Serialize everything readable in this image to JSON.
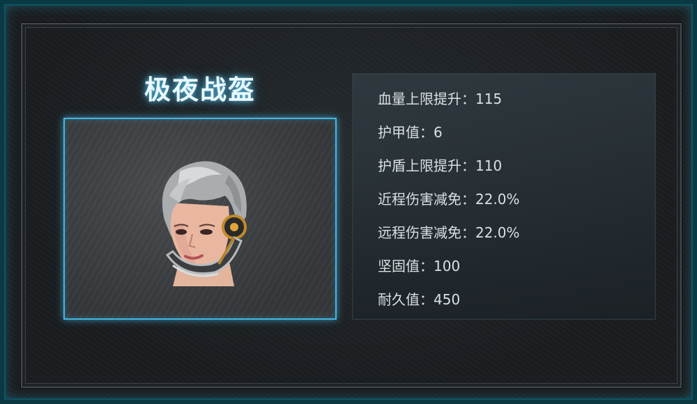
{
  "item": {
    "name": "极夜战盔"
  },
  "stats": [
    {
      "label": "血量上限提升：",
      "value": "115"
    },
    {
      "label": "护甲值：",
      "value": "6"
    },
    {
      "label": "护盾上限提升：",
      "value": "110"
    },
    {
      "label": "近程伤害减免：",
      "value": "22.0%"
    },
    {
      "label": "远程伤害减免：",
      "value": "22.0%"
    },
    {
      "label": "坚固值：",
      "value": "100"
    },
    {
      "label": "耐久值：",
      "value": "450"
    }
  ],
  "colors": {
    "frame_glow": "#3fb8e6",
    "text": "#d9e1e5",
    "title": "#eaf8ff"
  },
  "icons": {
    "preview": "helmet-portrait-icon"
  }
}
